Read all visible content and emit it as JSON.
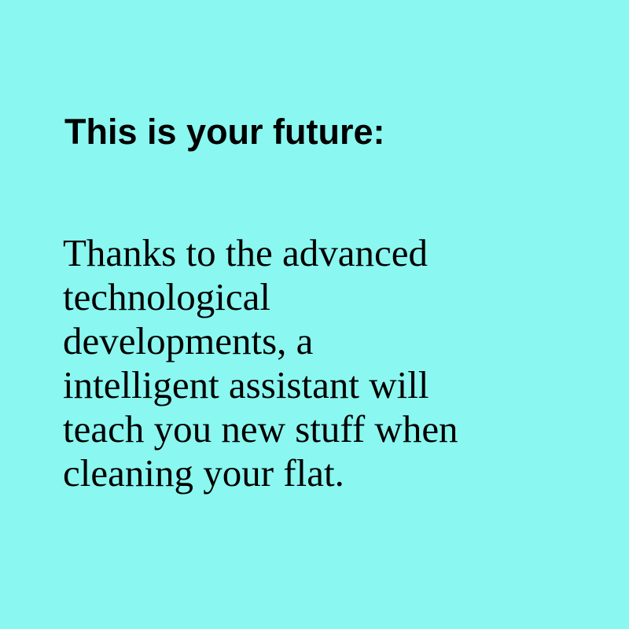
{
  "colors": {
    "background": "#8af7f0",
    "text": "#000000"
  },
  "headline": "This is your future:",
  "body_lines": [
    "Thanks to the advanced",
    "technological",
    "developments, a",
    "intelligent assistant will",
    "teach you new stuff when",
    "cleaning your flat."
  ]
}
